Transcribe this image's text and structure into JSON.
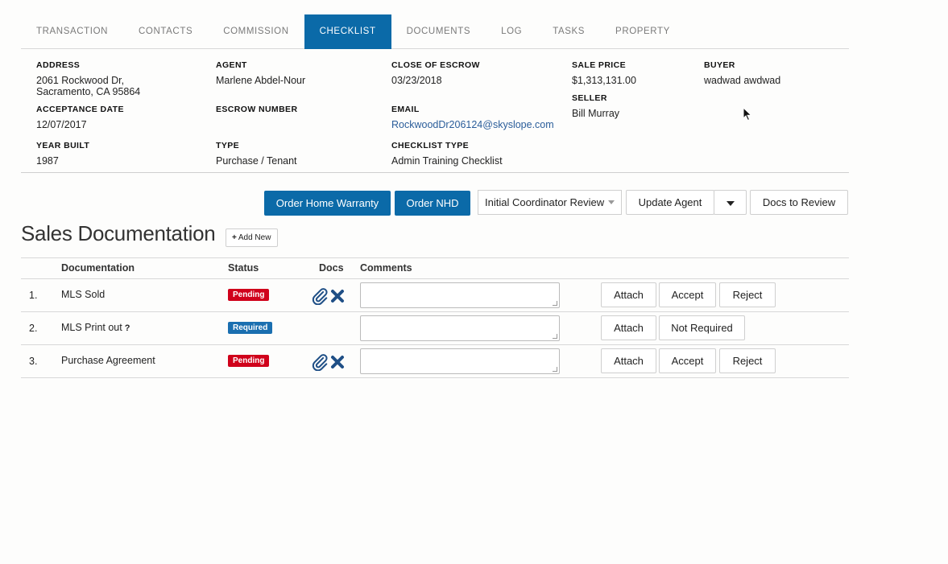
{
  "tabs": [
    {
      "label": "TRANSACTION"
    },
    {
      "label": "CONTACTS"
    },
    {
      "label": "COMMISSION"
    },
    {
      "label": "CHECKLIST"
    },
    {
      "label": "DOCUMENTS"
    },
    {
      "label": "LOG"
    },
    {
      "label": "TASKS"
    },
    {
      "label": "PROPERTY"
    }
  ],
  "active_tab": "CHECKLIST",
  "info": {
    "address": {
      "label": "ADDRESS",
      "line1": "2061 Rockwood Dr,",
      "line2": "Sacramento, CA 95864"
    },
    "agent": {
      "label": "AGENT",
      "value": "Marlene Abdel-Nour"
    },
    "close_of_escrow": {
      "label": "CLOSE OF ESCROW",
      "value": "03/23/2018"
    },
    "sale_price": {
      "label": "SALE PRICE",
      "value": "$1,313,131.00"
    },
    "buyer": {
      "label": "BUYER",
      "value": "wadwad awdwad"
    },
    "acceptance_date": {
      "label": "ACCEPTANCE DATE",
      "value": "12/07/2017"
    },
    "escrow_number": {
      "label": "ESCROW NUMBER",
      "value": ""
    },
    "email": {
      "label": "EMAIL",
      "value": "RockwoodDr206124@skyslope.com"
    },
    "seller": {
      "label": "SELLER",
      "value": "Bill Murray"
    },
    "year_built": {
      "label": "YEAR BUILT",
      "value": "1987"
    },
    "type": {
      "label": "TYPE",
      "value": "Purchase / Tenant"
    },
    "checklist_type": {
      "label": "CHECKLIST TYPE",
      "value": "Admin Training Checklist"
    }
  },
  "actions": {
    "order_home_warranty": "Order Home Warranty",
    "order_nhd": "Order NHD",
    "review_select": "Initial Coordinator Review",
    "update_agent": "Update Agent",
    "docs_to_review": "Docs to Review"
  },
  "section": {
    "title": "Sales Documentation",
    "add_new": "Add New"
  },
  "table": {
    "headers": {
      "documentation": "Documentation",
      "status": "Status",
      "docs": "Docs",
      "comments": "Comments"
    },
    "rows": [
      {
        "num": "1.",
        "name": "MLS Sold",
        "status": "Pending",
        "has_docs": true,
        "buttons": [
          "Attach",
          "Accept",
          "Reject"
        ]
      },
      {
        "num": "2.",
        "name": "MLS Print out",
        "help": "?",
        "status": "Required",
        "has_docs": false,
        "buttons": [
          "Attach",
          "Not Required"
        ]
      },
      {
        "num": "3.",
        "name": "Purchase Agreement",
        "status": "Pending",
        "has_docs": true,
        "buttons": [
          "Attach",
          "Accept",
          "Reject"
        ]
      }
    ]
  },
  "colors": {
    "primary": "#0b6aa8",
    "pending": "#d0021b",
    "required": "#1a6fb0",
    "icon": "#1f4f86"
  },
  "icons": [
    "paperclip-icon",
    "remove-x-icon",
    "plus-icon",
    "caret-down-icon",
    "mouse-cursor-icon"
  ]
}
